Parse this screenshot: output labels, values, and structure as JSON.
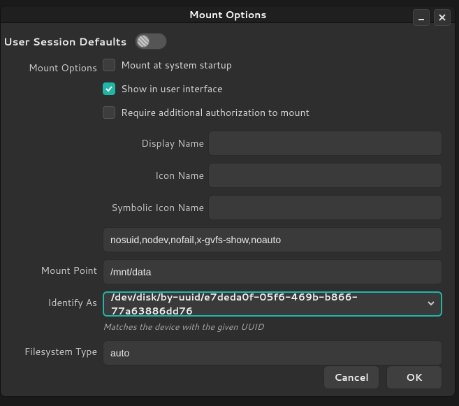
{
  "window": {
    "title": "Mount Options"
  },
  "session": {
    "label": "User Session Defaults",
    "enabled": false
  },
  "options": {
    "section_label": "Mount Options",
    "mount_startup": {
      "label": "Mount at system startup",
      "checked": false
    },
    "show_ui": {
      "label": "Show in user interface",
      "checked": true
    },
    "require_auth": {
      "label": "Require additional authorization to mount",
      "checked": false
    }
  },
  "fields": {
    "display_name": {
      "label": "Display Name",
      "value": ""
    },
    "icon_name": {
      "label": "Icon Name",
      "value": ""
    },
    "symbolic_icon": {
      "label": "Symbolic Icon Name",
      "value": ""
    },
    "mount_options": {
      "value": "nosuid,nodev,nofail,x-gvfs-show,noauto"
    },
    "mount_point": {
      "label": "Mount Point",
      "value": "/mnt/data"
    },
    "identify_as": {
      "label": "Identify As",
      "value": "/dev/disk/by-uuid/e7deda0f-05f6-469b-b866-77a63886dd76",
      "hint": "Matches the device with the given UUID"
    },
    "fs_type": {
      "label": "Filesystem Type",
      "value": "auto"
    }
  },
  "buttons": {
    "cancel": "Cancel",
    "ok": "OK"
  }
}
